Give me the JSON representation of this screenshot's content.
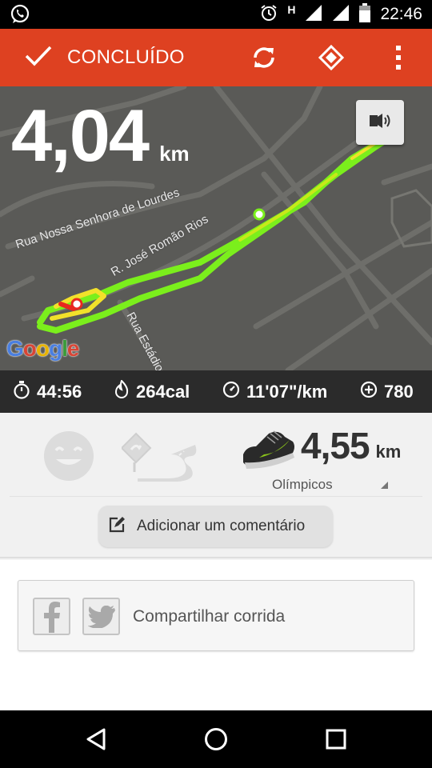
{
  "status_bar": {
    "time": "22:46",
    "network_letter": "H"
  },
  "app_bar": {
    "done_label": "CONCLUÍDO"
  },
  "map": {
    "distance_value": "4,04",
    "distance_unit": "km",
    "streets": [
      "Rua Nossa Senhora de Lourdes",
      "R. José Romão Rios",
      "Rua Estádio"
    ],
    "attribution": [
      "G",
      "o",
      "o",
      "g",
      "l",
      "e"
    ],
    "route_colors": {
      "fast": "#7bef1c",
      "medium": "#c8e81a",
      "slow": "#f2e12a",
      "start": "#e8281e"
    }
  },
  "stats": {
    "duration": "44:56",
    "calories": "264cal",
    "pace": "11'07\"/km",
    "fuel": "780"
  },
  "details": {
    "shoe_distance_value": "4,55",
    "shoe_distance_unit": "km",
    "shoe_name": "Olímpicos",
    "comment_button": "Adicionar um comentário"
  },
  "share": {
    "label": "Compartilhar corrida"
  },
  "colors": {
    "accent": "#de4121",
    "stats_bg": "#2b2b2b",
    "map_bg": "#5a5a57",
    "nike_green": "#8ac41a"
  }
}
